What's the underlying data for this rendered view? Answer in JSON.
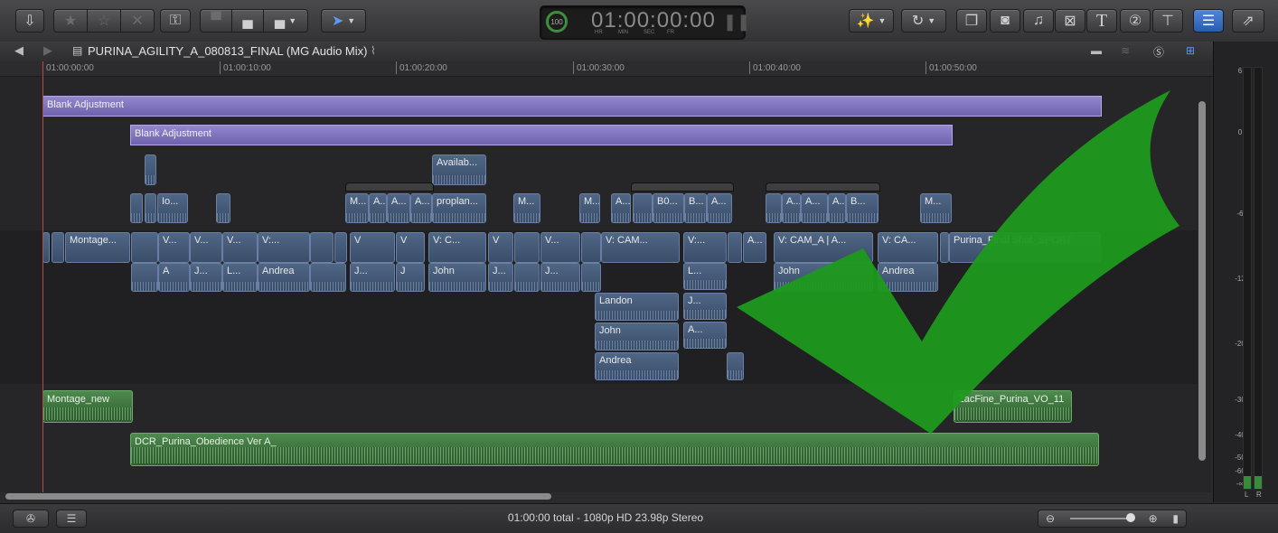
{
  "toolbar": {
    "import_icon": "import-media-icon",
    "rating_buttons": [
      "☆",
      "☆",
      "✕"
    ],
    "keyword_icon": "key-icon",
    "edit_buttons": [
      "connect",
      "insert",
      "append"
    ],
    "tool_icon": "select-arrow-icon",
    "timecode": {
      "percent": "100",
      "value": "01:00:00:00",
      "units": [
        "HR",
        "MIN",
        "SEC",
        "FR"
      ]
    },
    "right_icons": [
      "magic-wand-icon",
      "retime-icon",
      "browser-icon",
      "photo-icon",
      "music-icon",
      "transitions-icon",
      "titles-icon",
      "generators-icon",
      "themes-icon",
      "inspector-icon",
      "share-icon"
    ]
  },
  "timeline_header": {
    "project_name": "PURINA_AGILITY_A_080813_FINAL (MG Audio Mix)"
  },
  "ruler": {
    "ticks": [
      "01:00:00:00",
      "01:00:10:00",
      "01:00:20:00",
      "01:00:30:00",
      "01:00:40:00",
      "01:00:50:00"
    ]
  },
  "timeline": {
    "adjustment_clips": [
      "Blank Adjustment",
      "Blank Adjustment"
    ],
    "connected_top": [
      "Availab...",
      "Io...",
      "M...",
      "A...",
      "A...",
      "A...",
      "proplan...",
      "M...",
      "M...",
      "A...",
      "B0...",
      "B...",
      "A...",
      "A...",
      "A...",
      "A...",
      "B...",
      "M..."
    ],
    "storyline_clips": [
      "Montage...",
      "V...",
      "V...",
      "V...",
      "V:...",
      "V",
      "V",
      "V: C...",
      "V",
      "V...",
      "V: CAM...",
      "V:...",
      "A...",
      "V: CAM_A | A...",
      "V: CA...",
      "Purina_Final Shot_SPORT"
    ],
    "audio_clips": [
      "A",
      "J...",
      "L...",
      "Andrea",
      "J...",
      "J",
      "John",
      "J...",
      "J...",
      "L...",
      "John",
      "Andrea",
      "J...",
      "A...",
      "Landon",
      "John",
      "Andrea"
    ],
    "music_clips": [
      "Montage_new",
      "ZacFine_Purina_VO_11",
      "DCR_Purina_Obedience Ver A_"
    ]
  },
  "meters": {
    "scale": [
      "6",
      "0",
      "-6",
      "-12",
      "-20",
      "-30",
      "-40",
      "-50",
      "-60",
      "-∞"
    ],
    "channels": [
      "L",
      "R"
    ]
  },
  "status": {
    "text": "01:00:00 total - 1080p HD 23.98p Stereo"
  },
  "colors": {
    "adjustment": "#8478c4",
    "video_clip": "#4a5f80",
    "audio_clip": "#3f7a3f",
    "checkmark": "#1e9a1e"
  }
}
